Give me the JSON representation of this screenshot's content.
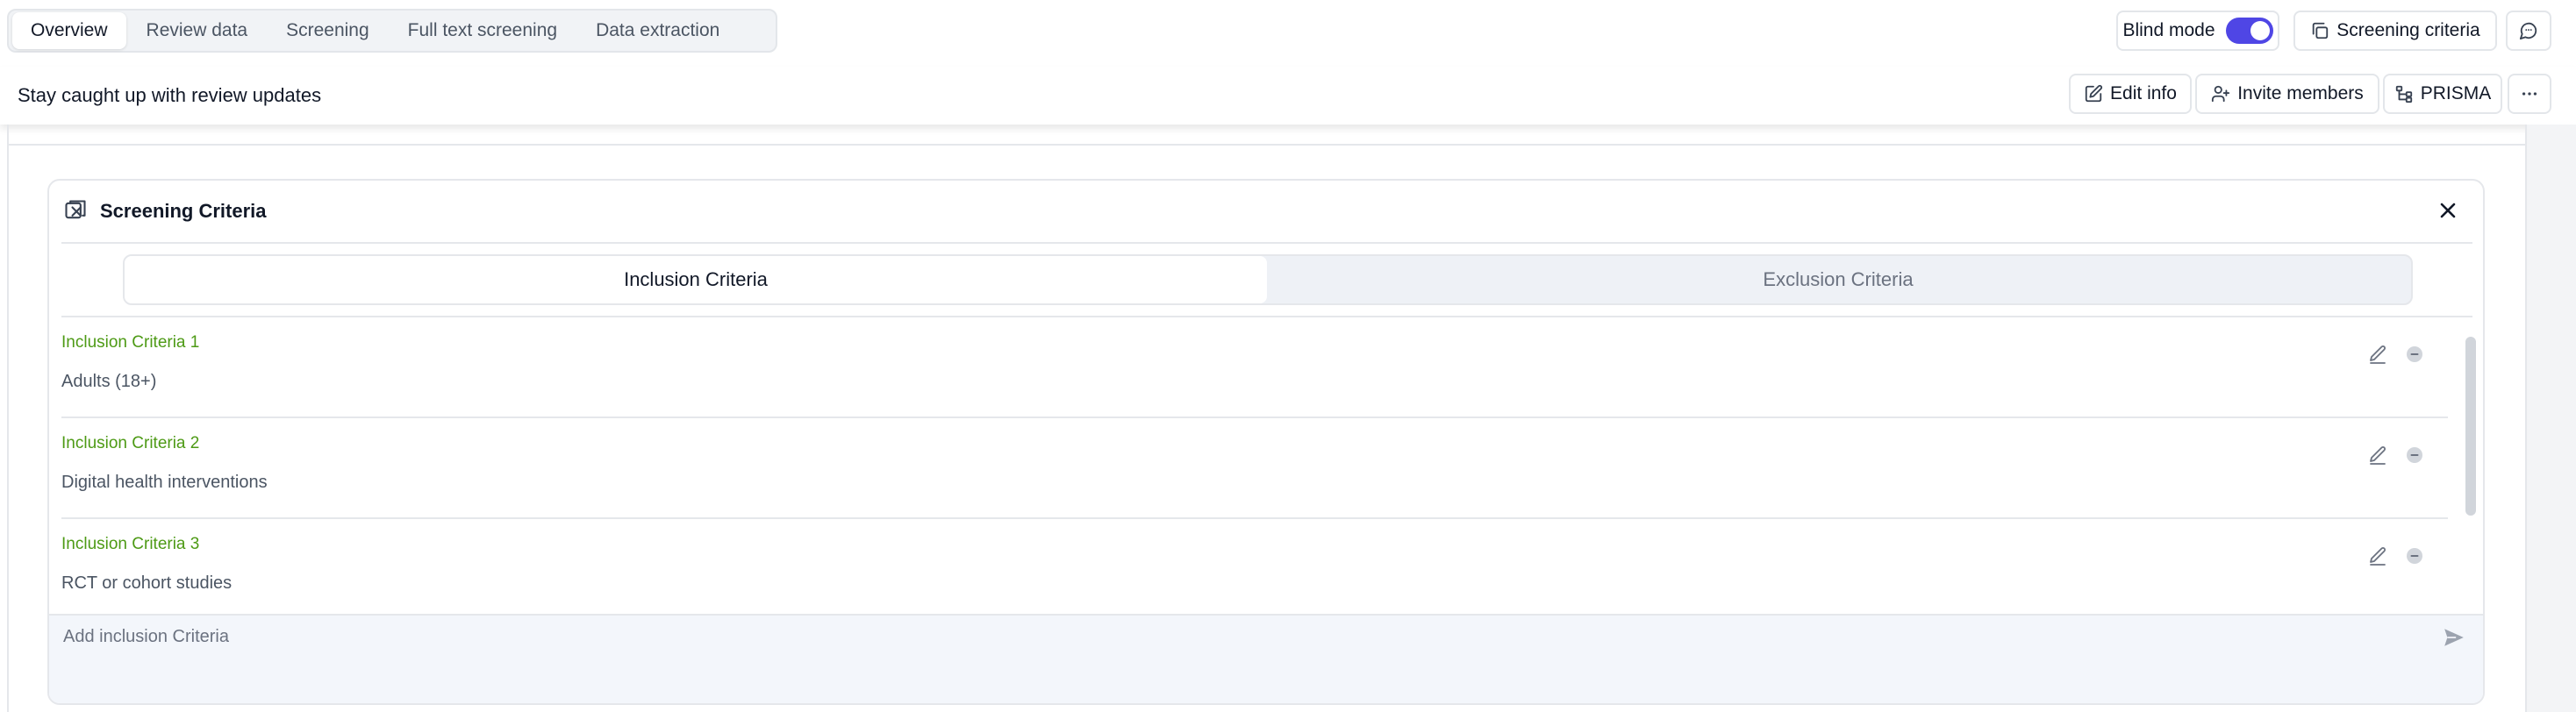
{
  "nav": {
    "tabs": [
      {
        "label": "Overview"
      },
      {
        "label": "Review data"
      },
      {
        "label": "Screening"
      },
      {
        "label": "Full text screening"
      },
      {
        "label": "Data extraction"
      }
    ],
    "blind_mode_label": "Blind mode",
    "blind_mode_on": true,
    "screening_criteria_label": "Screening criteria",
    "chat_icon": "message-circle-icon"
  },
  "subheader": {
    "text": "Stay caught up with review updates",
    "edit_info_label": "Edit info",
    "invite_members_label": "Invite members",
    "prisma_label": "PRISMA",
    "more_icon": "ellipsis-icon"
  },
  "card": {
    "title": "Screening Criteria",
    "tabs": {
      "inclusion": "Inclusion Criteria",
      "exclusion": "Exclusion Criteria",
      "active": "inclusion"
    },
    "items": [
      {
        "title": "Inclusion Criteria 1",
        "text": "Adults (18+)"
      },
      {
        "title": "Inclusion Criteria 2",
        "text": "Digital health interventions"
      },
      {
        "title": "Inclusion Criteria 3",
        "text": "RCT or cohort studies"
      }
    ],
    "add_placeholder": "Add inclusion Criteria"
  },
  "colors": {
    "accent": "#4f46e5",
    "criteria_title": "#4d9a15"
  }
}
